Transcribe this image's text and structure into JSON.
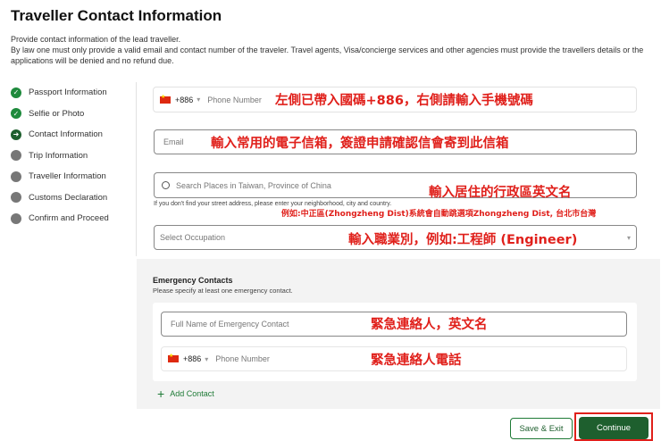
{
  "page": {
    "title": "Traveller Contact Information",
    "intro_line1": "Provide contact information of the lead traveller.",
    "intro_line2": "By law one must only provide a valid email and contact number of the traveler. Travel agents, Visa/concierge services and other agencies must provide the travellers details or the applications will be denied and no refund due."
  },
  "steps": [
    {
      "label": "Passport Information",
      "status": "done",
      "icon": "check-icon"
    },
    {
      "label": "Selfie or Photo",
      "status": "done",
      "icon": "check-icon"
    },
    {
      "label": "Contact Information",
      "status": "current",
      "icon": "arrow-right-icon"
    },
    {
      "label": "Trip Information",
      "status": "pending",
      "icon": "circle-icon"
    },
    {
      "label": "Traveller Information",
      "status": "pending",
      "icon": "circle-icon"
    },
    {
      "label": "Customs Declaration",
      "status": "pending",
      "icon": "circle-icon"
    },
    {
      "label": "Confirm and Proceed",
      "status": "pending",
      "icon": "circle-icon"
    }
  ],
  "form": {
    "phone_code": "+886",
    "phone_placeholder": "Phone Number",
    "email_placeholder": "Email",
    "address_placeholder": "Search Places in Taiwan, Province of China",
    "address_hint": "If you don't find your street address, please enter your neighborhood, city and country.",
    "occupation_placeholder": "Select Occupation"
  },
  "emergency": {
    "title": "Emergency Contacts",
    "subtitle": "Please specify at least one emergency contact.",
    "name_placeholder": "Full Name of Emergency Contact",
    "phone_code": "+886",
    "phone_placeholder": "Phone Number",
    "add_contact": "Add Contact"
  },
  "annotations": {
    "phone": "左側已帶入國碼+886，右側請輸入手機號碼",
    "email": "輸入常用的電子信箱，簽證申請確認信會寄到此信箱",
    "address": "輸入居住的行政區英文名",
    "address_example": "例如:中正區(Zhongzheng Dist)系統會自動跳選項Zhongzheng Dist, 台北市台灣",
    "occupation": "輸入職業別，例如:工程師 (Engineer)",
    "emergency_name": "緊急連絡人，英文名",
    "emergency_phone": "緊急連絡人電話"
  },
  "buttons": {
    "save_exit": "Save & Exit",
    "continue": "Continue"
  },
  "colors": {
    "brand_green": "#1e5f2e",
    "done_green": "#1e8a3c",
    "annotation_red": "#e0201b"
  }
}
